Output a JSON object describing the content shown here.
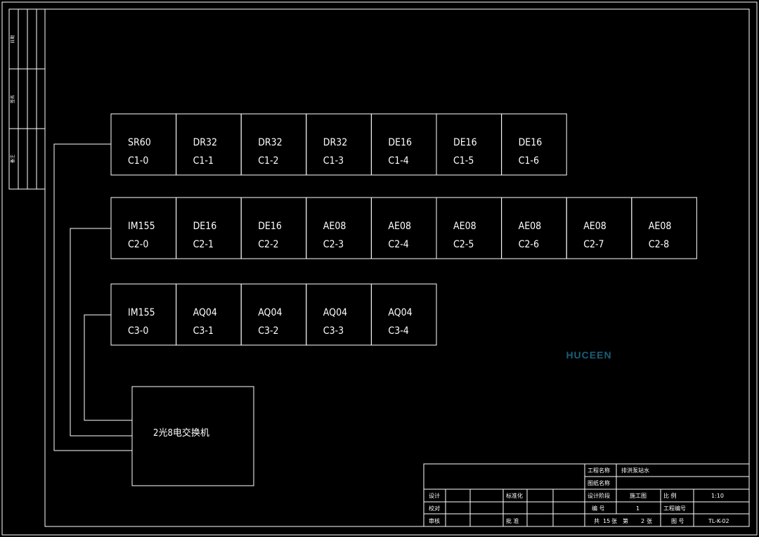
{
  "left_strip": [
    "日期",
    "签名",
    "备注"
  ],
  "rows": [
    {
      "modules": [
        {
          "model": "SR60",
          "slot": "C1-0"
        },
        {
          "model": "DR32",
          "slot": "C1-1"
        },
        {
          "model": "DR32",
          "slot": "C1-2"
        },
        {
          "model": "DR32",
          "slot": "C1-3"
        },
        {
          "model": "DE16",
          "slot": "C1-4"
        },
        {
          "model": "DE16",
          "slot": "C1-5"
        },
        {
          "model": "DE16",
          "slot": "C1-6"
        }
      ]
    },
    {
      "modules": [
        {
          "model": "IM155",
          "slot": "C2-0"
        },
        {
          "model": "DE16",
          "slot": "C2-1"
        },
        {
          "model": "DE16",
          "slot": "C2-2"
        },
        {
          "model": "AE08",
          "slot": "C2-3"
        },
        {
          "model": "AE08",
          "slot": "C2-4"
        },
        {
          "model": "AE08",
          "slot": "C2-5"
        },
        {
          "model": "AE08",
          "slot": "C2-6"
        },
        {
          "model": "AE08",
          "slot": "C2-7"
        },
        {
          "model": "AE08",
          "slot": "C2-8"
        }
      ]
    },
    {
      "modules": [
        {
          "model": "IM155",
          "slot": "C3-0"
        },
        {
          "model": "AQ04",
          "slot": "C3-1"
        },
        {
          "model": "AQ04",
          "slot": "C3-2"
        },
        {
          "model": "AQ04",
          "slot": "C3-3"
        },
        {
          "model": "AQ04",
          "slot": "C3-4"
        }
      ]
    }
  ],
  "switch_label": "2光8电交换机",
  "watermark": "HUCEEN",
  "title_block": {
    "project_name_label": "工程名称",
    "project_name_value": "排洪泵站水",
    "drawing_name_label": "图纸名称",
    "design_label": "设计",
    "standard_label": "标准化",
    "design_stage_label": "设计阶段",
    "design_stage_value": "施工图",
    "scale_label": "比 例",
    "scale_value": "1:10",
    "check_label": "校对",
    "sheet_no_label": "编 号",
    "sheet_no_value": "1",
    "project_no_label": "工程编号",
    "review_label": "审核",
    "approve_label": "批 准",
    "total_label": "共",
    "total_value": "15",
    "total_unit": "张",
    "page_label": "第",
    "page_value": "2",
    "page_unit": "张",
    "drawing_no_label": "图 号",
    "drawing_no_value": "TL-K-02"
  },
  "colors": {
    "background": "#000000",
    "lines": "#ffffff",
    "watermark": "#1a5f79"
  }
}
